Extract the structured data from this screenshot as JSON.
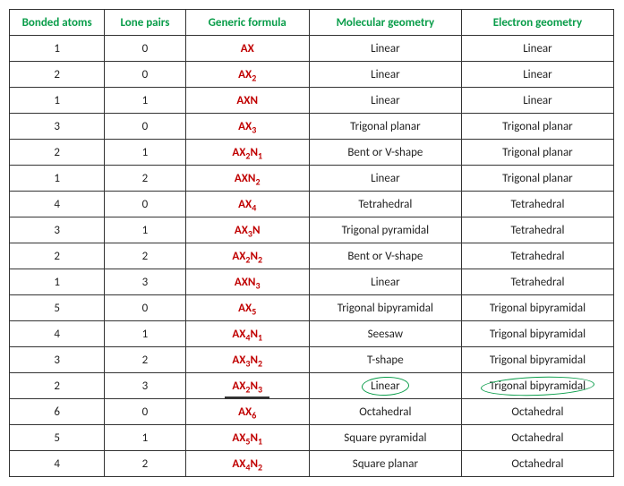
{
  "headers": {
    "c1": "Bonded atoms",
    "c2": "Lone pairs",
    "c3": "Generic formula",
    "c4": "Molecular geometry",
    "c5": "Electron geometry"
  },
  "rows": [
    {
      "bonded": "1",
      "lone": "0",
      "formula_html": "AX",
      "mol": "Linear",
      "elec": "Linear"
    },
    {
      "bonded": "2",
      "lone": "0",
      "formula_html": "AX<sub>2</sub>",
      "mol": "Linear",
      "elec": "Linear"
    },
    {
      "bonded": "1",
      "lone": "1",
      "formula_html": "AXN",
      "mol": "Linear",
      "elec": "Linear"
    },
    {
      "bonded": "3",
      "lone": "0",
      "formula_html": "AX<sub>3</sub>",
      "mol": "Trigonal planar",
      "elec": "Trigonal planar"
    },
    {
      "bonded": "2",
      "lone": "1",
      "formula_html": "AX<sub>2</sub>N<sub>1</sub>",
      "mol": "Bent or V-shape",
      "elec": "Trigonal planar"
    },
    {
      "bonded": "1",
      "lone": "2",
      "formula_html": "AXN<sub>2</sub>",
      "mol": "Linear",
      "elec": "Trigonal planar"
    },
    {
      "bonded": "4",
      "lone": "0",
      "formula_html": "AX<sub>4</sub>",
      "mol": "Tetrahedral",
      "elec": "Tetrahedral"
    },
    {
      "bonded": "3",
      "lone": "1",
      "formula_html": "AX<sub>3</sub>N",
      "mol": "Trigonal pyramidal",
      "elec": "Tetrahedral"
    },
    {
      "bonded": "2",
      "lone": "2",
      "formula_html": "AX<sub>2</sub>N<sub>2</sub>",
      "mol": "Bent or V-shape",
      "elec": "Tetrahedral"
    },
    {
      "bonded": "1",
      "lone": "3",
      "formula_html": "AXN<sub>3</sub>",
      "mol": "Linear",
      "elec": "Tetrahedral"
    },
    {
      "bonded": "5",
      "lone": "0",
      "formula_html": "AX<sub>5</sub>",
      "mol": "Trigonal bipyramidal",
      "elec": "Trigonal bipyramidal"
    },
    {
      "bonded": "4",
      "lone": "1",
      "formula_html": "AX<sub>4</sub>N<sub>1</sub>",
      "mol": "Seesaw",
      "elec": "Trigonal bipyramidal"
    },
    {
      "bonded": "3",
      "lone": "2",
      "formula_html": "AX<sub>3</sub>N<sub>2</sub>",
      "mol": "T-shape",
      "elec": "Trigonal bipyramidal"
    },
    {
      "bonded": "2",
      "lone": "3",
      "formula_html": "AX<sub>2</sub>N<sub>3</sub>",
      "mol": "Linear",
      "elec": "Trigonal bipyramidal",
      "highlighted": true
    },
    {
      "bonded": "6",
      "lone": "0",
      "formula_html": "AX<sub>6</sub>",
      "mol": "Octahedral",
      "elec": "Octahedral"
    },
    {
      "bonded": "5",
      "lone": "1",
      "formula_html": "AX<sub>5</sub>N<sub>1</sub>",
      "mol": "Square pyramidal",
      "elec": "Octahedral"
    },
    {
      "bonded": "4",
      "lone": "2",
      "formula_html": "AX<sub>4</sub>N<sub>2</sub>",
      "mol": "Square planar",
      "elec": "Octahedral"
    }
  ]
}
